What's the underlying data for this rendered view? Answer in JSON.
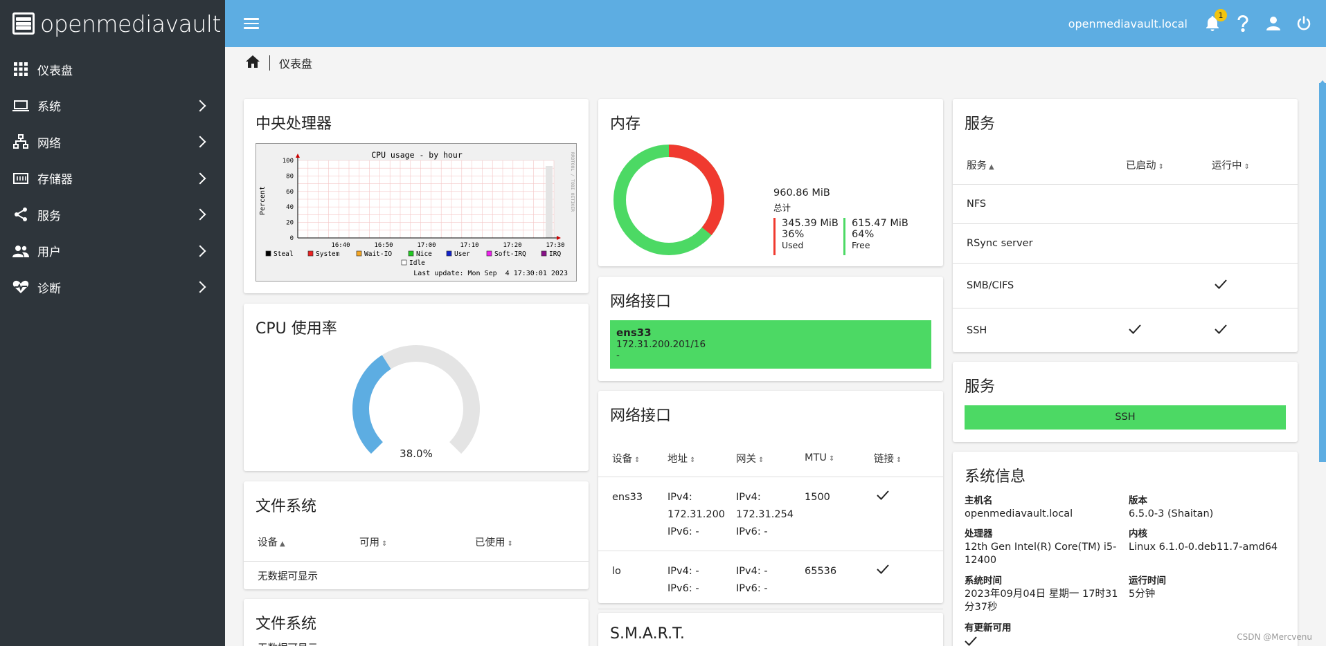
{
  "brand": {
    "name": "openmediavault"
  },
  "sidebar": {
    "items": [
      {
        "label": "仪表盘",
        "icon": "grid-icon"
      },
      {
        "label": "系统",
        "icon": "laptop-icon"
      },
      {
        "label": "网络",
        "icon": "network-icon"
      },
      {
        "label": "存储器",
        "icon": "storage-icon"
      },
      {
        "label": "服务",
        "icon": "share-icon"
      },
      {
        "label": "用户",
        "icon": "users-icon"
      },
      {
        "label": "诊断",
        "icon": "heartbeat-icon"
      }
    ]
  },
  "topbar": {
    "hostname": "openmediavault.local",
    "notification_count": "1"
  },
  "breadcrumb": {
    "current": "仪表盘"
  },
  "cpu": {
    "title": "中央处理器",
    "chart_data": {
      "type": "area",
      "title": "CPU usage - by hour",
      "ylabel": "Percent",
      "side_label": "RRDTOOL / TOBI OETIKER",
      "y_ticks": [
        "100",
        "80",
        "60",
        "40",
        "20",
        "0"
      ],
      "x_ticks": [
        "16:40",
        "16:50",
        "17:00",
        "17:10",
        "17:20",
        "17:30"
      ],
      "ylim": [
        0,
        100
      ],
      "legend": [
        {
          "name": "Steal",
          "color": "#000000"
        },
        {
          "name": "System",
          "color": "#ee2222"
        },
        {
          "name": "Wait-IO",
          "color": "#f5a623"
        },
        {
          "name": "Nice",
          "color": "#22cc22"
        },
        {
          "name": "User",
          "color": "#1122cc"
        },
        {
          "name": "Soft-IRQ",
          "color": "#ee22ee"
        },
        {
          "name": "IRQ",
          "color": "#881188"
        },
        {
          "name": "Idle",
          "color": "#ffffff"
        }
      ],
      "last_update": "Last update: Mon Sep  4 17:30:01 2023"
    }
  },
  "cpu_usage": {
    "title": "CPU 使用率",
    "value": 38.0,
    "value_label": "38.0%"
  },
  "filesystem": {
    "title": "文件系统",
    "columns": [
      "设备",
      "可用",
      "已使用"
    ],
    "empty": "无数据可显示"
  },
  "filesystem2": {
    "title": "文件系统",
    "empty": "无数据可显示"
  },
  "memory": {
    "title": "内存",
    "total": "960.86 MiB",
    "total_label": "总计",
    "used": "345.39 MiB",
    "used_pct": "36%",
    "used_label": "Used",
    "free": "615.47 MiB",
    "free_pct": "64%",
    "free_label": "Free",
    "used_fraction": 0.36,
    "colors": {
      "used": "#f03a2f",
      "free": "#4cd964"
    }
  },
  "netif_card": {
    "title": "网络接口",
    "name": "ens33",
    "address": "172.31.200.201/16",
    "extra": "-"
  },
  "netif_table": {
    "title": "网络接口",
    "columns": [
      "设备",
      "地址",
      "网关",
      "MTU",
      "链接"
    ],
    "rows": [
      {
        "device": "ens33",
        "address": [
          "IPv4:",
          "172.31.200",
          "IPv6: -"
        ],
        "gateway": [
          "IPv4:",
          "172.31.254",
          "IPv6: -"
        ],
        "mtu": "1500",
        "link": true
      },
      {
        "device": "lo",
        "address": [
          "IPv4: -",
          "IPv6: -"
        ],
        "gateway": [
          "IPv4: -",
          "IPv6: -"
        ],
        "mtu": "65536",
        "link": true
      }
    ]
  },
  "smart": {
    "title": "S.M.A.R.T."
  },
  "services": {
    "title": "服务",
    "columns": [
      "服务",
      "已启动",
      "运行中"
    ],
    "rows": [
      {
        "name": "NFS",
        "started": false,
        "running": false
      },
      {
        "name": "RSync server",
        "started": false,
        "running": false
      },
      {
        "name": "SMB/CIFS",
        "started": false,
        "running": true
      },
      {
        "name": "SSH",
        "started": true,
        "running": true
      }
    ]
  },
  "services_status": {
    "title": "服务",
    "item": "SSH"
  },
  "sysinfo": {
    "title": "系统信息",
    "hostname_label": "主机名",
    "hostname": "openmediavault.local",
    "version_label": "版本",
    "version": "6.5.0-3 (Shaitan)",
    "cpu_label": "处理器",
    "cpu": "12th Gen Intel(R) Core(TM) i5-12400",
    "kernel_label": "内核",
    "kernel": "Linux 6.1.0-0.deb11.7-amd64",
    "time_label": "系统时间",
    "time": "2023年09月04日 星期一 17时31分37秒",
    "uptime_label": "运行时间",
    "uptime": "5分钟",
    "updates_label": "有更新可用"
  },
  "watermark": "CSDN @Mercvenu"
}
